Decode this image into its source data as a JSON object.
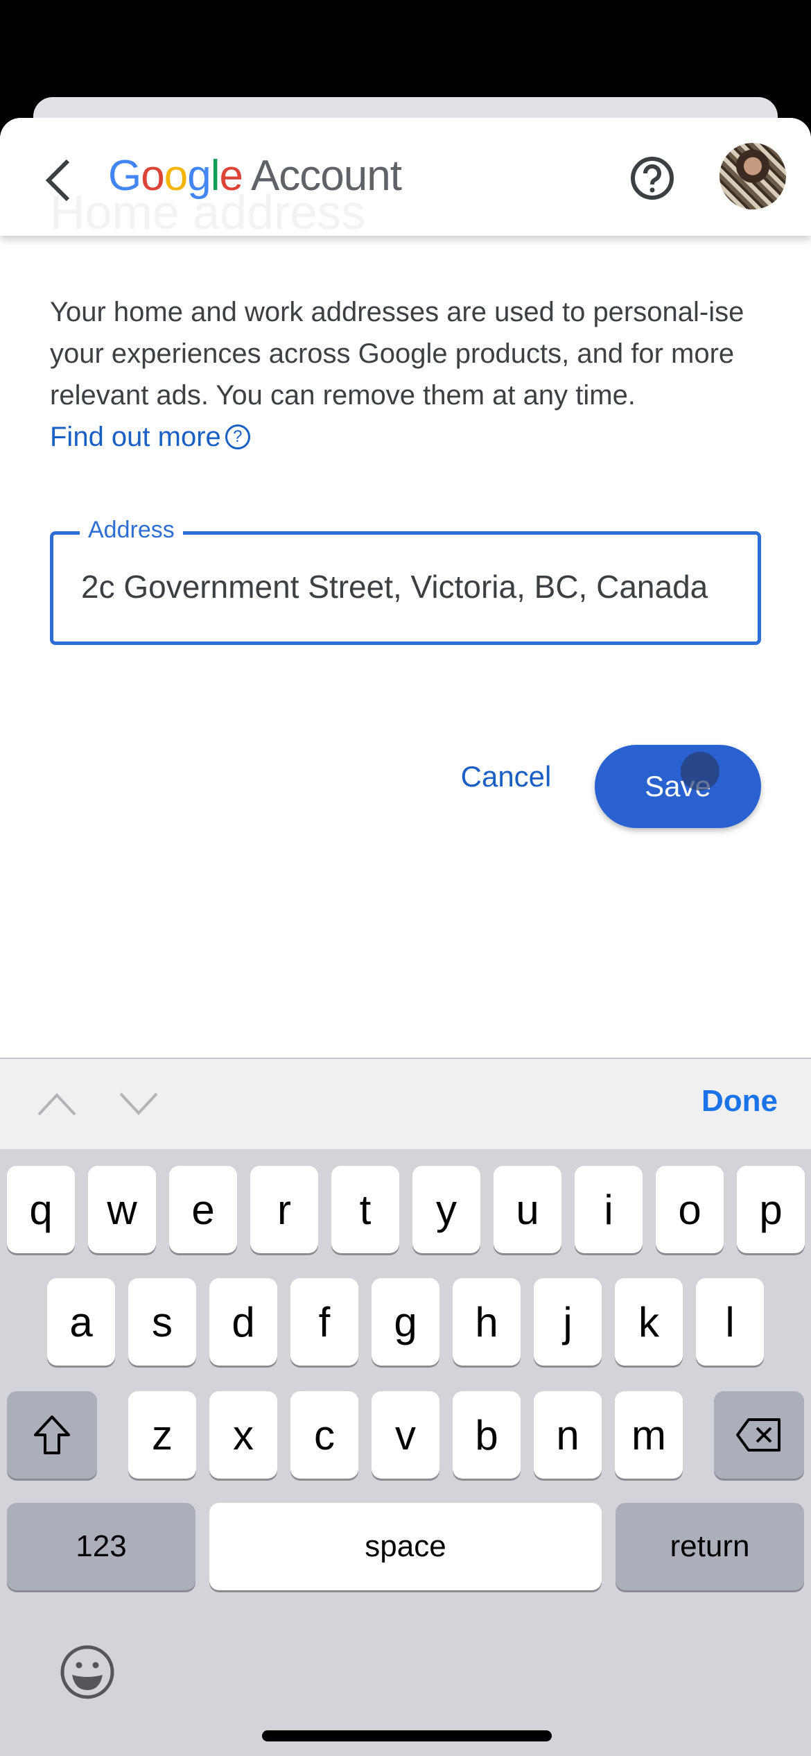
{
  "header": {
    "logo_google_letters": [
      "G",
      "o",
      "o",
      "g",
      "l",
      "e"
    ],
    "logo_account": "Account",
    "ghost_title": "Home address",
    "icons": {
      "back": "chevron-left-icon",
      "help": "help-circle-icon",
      "avatar": "profile-photo"
    }
  },
  "content": {
    "description": "Your home and work addresses are used to personal-ise your experiences across Google products, and for more relevant ads. You can remove them at any time.",
    "find_out_more": "Find out more",
    "find_out_more_icon": "?",
    "address_label": "Address",
    "address_value": "2c Government Street, Victoria, BC, Canada",
    "cancel_label": "Cancel",
    "save_label": "Save"
  },
  "accessory": {
    "done_label": "Done"
  },
  "keyboard": {
    "row1": [
      "q",
      "w",
      "e",
      "r",
      "t",
      "y",
      "u",
      "i",
      "o",
      "p"
    ],
    "row2": [
      "a",
      "s",
      "d",
      "f",
      "g",
      "h",
      "j",
      "k",
      "l"
    ],
    "row3": [
      "z",
      "x",
      "c",
      "v",
      "b",
      "n",
      "m"
    ],
    "numbers_label": "123",
    "space_label": "space",
    "return_label": "return"
  },
  "colors": {
    "accent": "#2962d0",
    "link": "#1a5fc4",
    "done": "#1a73e8"
  }
}
